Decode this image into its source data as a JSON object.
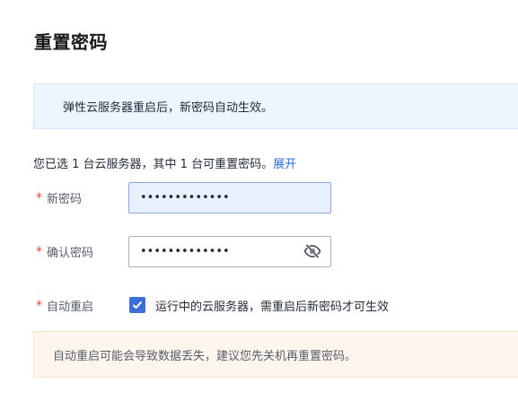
{
  "page": {
    "title": "重置密码"
  },
  "info_banner": {
    "text": "弹性云服务器重启后，新密码自动生效。"
  },
  "selection": {
    "summary": "您已选 1 台云服务器，其中 1 台可重置密码。",
    "expand_link": "展开"
  },
  "form": {
    "required_mark": "*",
    "new_password": {
      "label": "新密码",
      "value": "•••••••••••••"
    },
    "confirm_password": {
      "label": "确认密码",
      "value": "•••••••••••••",
      "toggle_icon": "eye-slash-icon"
    },
    "auto_restart": {
      "label": "自动重启",
      "checked": true,
      "checkbox_label": "运行中的云服务器，需重启后新密码才可生效"
    }
  },
  "warning_banner": {
    "text": "自动重启可能会导致数据丢失，建议您先关机再重置密码。"
  },
  "colors": {
    "accent": "#3e6ed8",
    "link": "#2e6be6",
    "required": "#e8453c",
    "info_bg": "#eef5fe",
    "warning_bg": "#fef5ec"
  }
}
